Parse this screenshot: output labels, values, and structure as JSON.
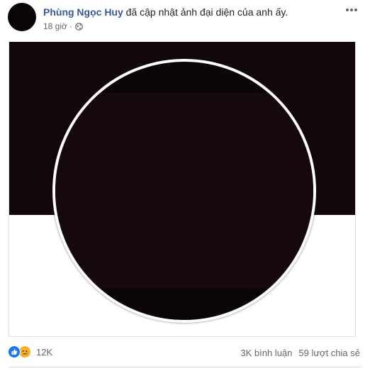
{
  "post": {
    "author": "Phùng Ngọc Huy",
    "action": " đã cập nhật ảnh đại diện của anh ấy.",
    "time": "18 giờ",
    "separator": "·",
    "privacy_icon": "globe-icon",
    "more_icon": "more-horizontal-icon"
  },
  "photo": {
    "cover_color": "#12070d",
    "profile_color": "#0c0508"
  },
  "footer": {
    "reaction_icons": [
      "like-icon",
      "sad-icon"
    ],
    "reaction_count": "12K",
    "comments": "3K bình luận",
    "shares": "59 lượt chia sẻ"
  },
  "colors": {
    "author_link": "#385898",
    "text": "#1d2129",
    "meta": "#616770",
    "like_blue": "#1877f2",
    "sad_yellow": "#f7b125"
  }
}
